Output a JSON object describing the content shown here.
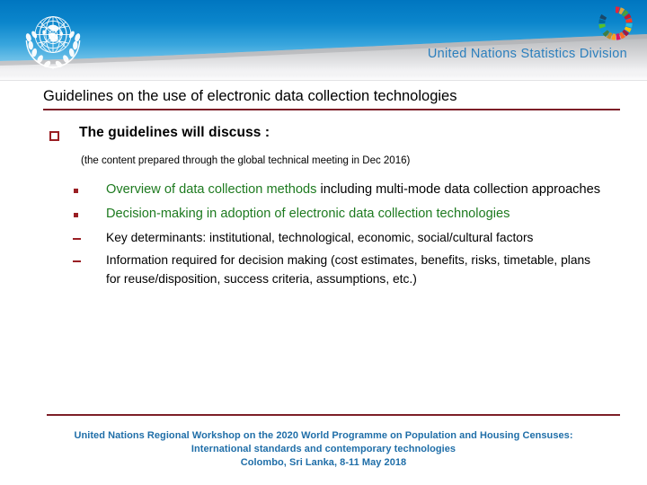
{
  "header": {
    "organization": "United Nations Statistics Division",
    "un_logo_icon": "un-emblem-icon",
    "sdg_logo_icon": "sdg-color-wheel-icon",
    "banner_top_color": "#0076c0",
    "banner_bottom_color": "#a9dbf2",
    "organization_color": "#2b7fbd"
  },
  "slide": {
    "title": "Guidelines on the use of electronic data collection technologies",
    "title_rule_color": "#7d1f28",
    "accent_color": "#9a1f24",
    "highlight_color": "#1d7a1f",
    "level1": {
      "bullet_icon": "hollow-square-bullet-icon",
      "text": "The guidelines  will discuss :"
    },
    "note": "(the content prepared through the global technical meeting in Dec 2016)",
    "bullets": [
      {
        "marker": "filled-square-bullet-icon",
        "level": 2,
        "highlight": "Overview of data collection methods",
        "rest": " including multi-mode data collection approaches"
      },
      {
        "marker": "filled-square-bullet-icon",
        "level": 2,
        "highlight": "Decision-making in adoption of electronic data collection technologies",
        "rest": ""
      },
      {
        "marker": "dash-bullet-icon",
        "level": 3,
        "highlight": "",
        "rest": "Key determinants: institutional, technological, economic, social/cultural factors"
      },
      {
        "marker": "dash-bullet-icon",
        "level": 3,
        "highlight": "",
        "rest": "Information required for decision making (cost estimates, benefits, risks, timetable, plans for reuse/disposition, success criteria, assumptions, etc.)"
      }
    ]
  },
  "footer": {
    "rule_color": "#7d1f28",
    "text_color": "#1f6ea8",
    "line1": "United Nations Regional Workshop on the 2020 World Programme on Population and Housing Censuses:",
    "line2": "International standards and contemporary technologies",
    "line3": "Colombo, Sri Lanka, 8-11 May 2018"
  }
}
